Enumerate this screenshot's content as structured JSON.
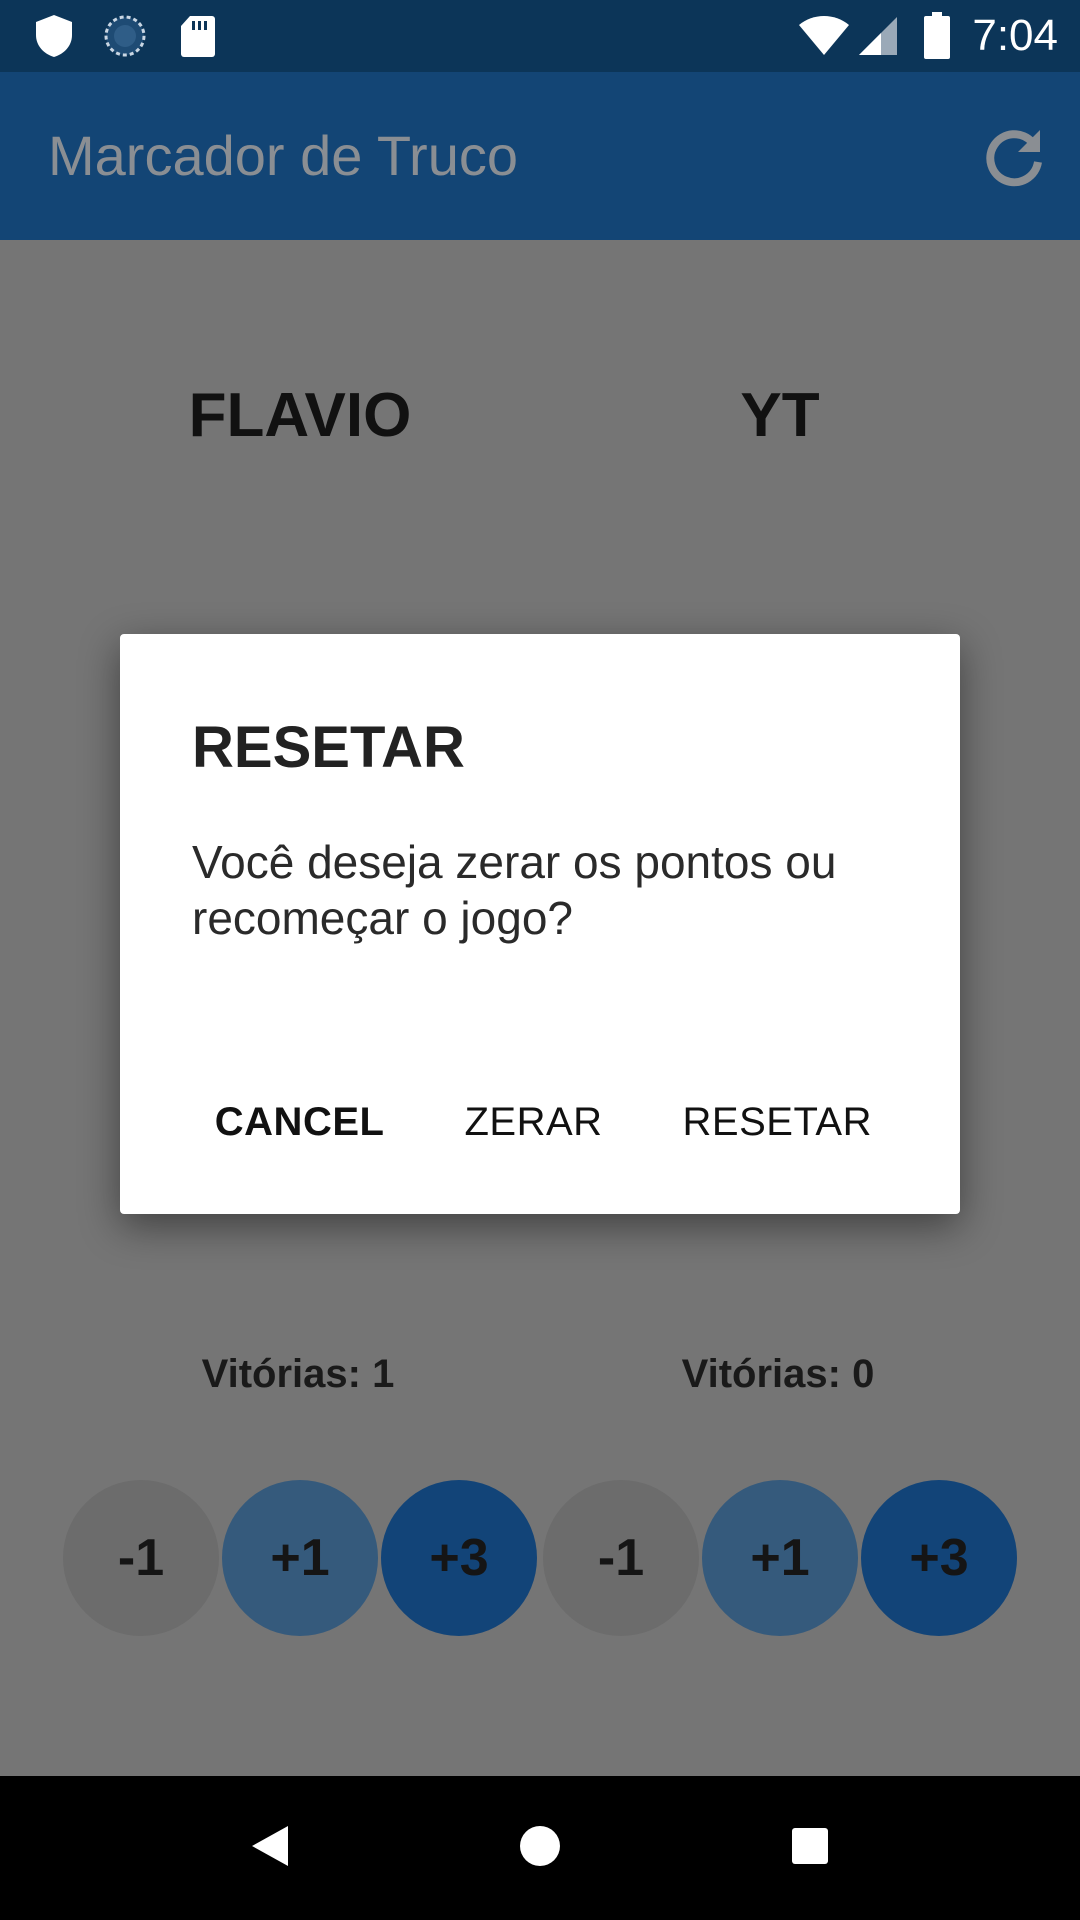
{
  "status_bar": {
    "icons": [
      "shield-icon",
      "sync-icon",
      "sd-card-icon",
      "wifi-icon",
      "signal-icon",
      "battery-icon"
    ],
    "time": "7:04"
  },
  "app_bar": {
    "title": "Marcador de Truco",
    "refresh_icon": "refresh-icon"
  },
  "teams": [
    {
      "name": "FLAVIO",
      "victories": "Vitórias: 1",
      "buttons": [
        "-1",
        "+1",
        "+3"
      ]
    },
    {
      "name": "YT",
      "victories": "Vitórias: 0",
      "buttons": [
        "-1",
        "+1",
        "+3"
      ]
    }
  ],
  "dialog": {
    "title": "RESETAR",
    "message": "Você deseja zerar os pontos ou recomeçar o jogo?",
    "actions": {
      "cancel": "CANCEL",
      "zerar": "ZERAR",
      "resetar": "RESETAR"
    }
  },
  "nav_bar": {
    "icons": [
      "back-icon",
      "home-icon",
      "recents-icon"
    ]
  },
  "colors": {
    "status_bar": "#0c3558",
    "app_bar": "#134575",
    "scrim": "#757575",
    "button_minus": "#6c6c6c",
    "button_plus1": "#355a7c",
    "button_plus3": "#124478"
  }
}
